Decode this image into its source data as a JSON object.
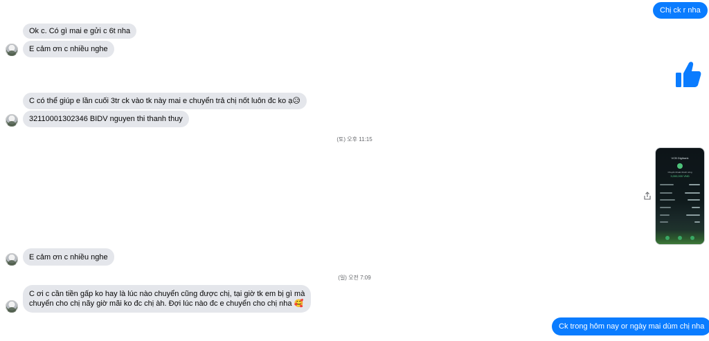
{
  "messages": {
    "out_1": "Chị ck r nha",
    "in_1": "Ok c. Có gì mai e gửi c 6t nha",
    "in_2": "E cảm ơn c nhiều nghe",
    "in_3": "C có thể giúp e lần cuối 3tr ck vào tk này mai e chuyển trả chị nốt luôn đc ko ạ😥",
    "in_4": "32110001302346 BIDV  nguyen thi thanh thuy",
    "timestamp_1": "(토) 오후 11:15",
    "in_5": "E cảm ơn c nhiều nghe",
    "timestamp_2": "(일) 오전 7:09",
    "in_6_line1": "C ơi c cần tiền gấp ko hay là lúc nào chuyển cũng được chị, tại giờ tk em bị gì mà",
    "in_6_line2": "chuyển cho chị nãy giờ mãi ko đc chị àh. Đợi lúc nào đc e chuyển cho chị nha 🥰",
    "out_2": "Ck trong hôm nay or ngày mai dùm chị nha"
  },
  "attachment": {
    "bank_name": "VCB Digibank",
    "status_text": "Chuyển khoản thành công",
    "amount": "3,000,000 VND"
  },
  "icons": {
    "like": "thumbs-up-icon",
    "share": "share-icon",
    "avatar": "contact-avatar"
  },
  "colors": {
    "outgoing_bubble": "#0a7cff",
    "incoming_bubble": "#e4e6eb",
    "like_icon": "#0a7cff"
  }
}
